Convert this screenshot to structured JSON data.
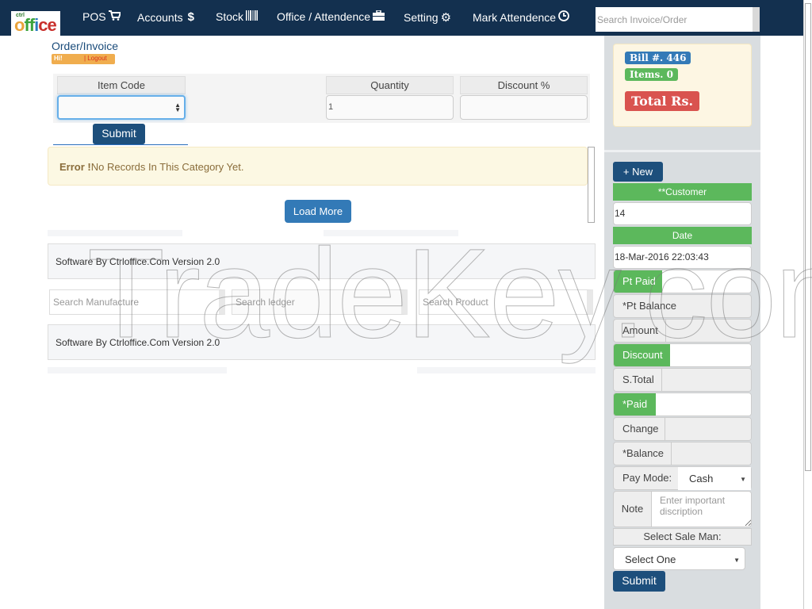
{
  "navbar": {
    "logo": {
      "small": "ctrl",
      "main": "office"
    },
    "items": [
      {
        "label": "POS",
        "icon": "shopping-cart-icon",
        "glyph": "🛒"
      },
      {
        "label": "Accounts",
        "icon": "dollar-icon",
        "glyph": "$"
      },
      {
        "label": "Stock",
        "icon": "barcode-icon",
        "glyph": "▌▌▌"
      },
      {
        "label": "Office / Attendence",
        "icon": "briefcase-icon",
        "glyph": "💼"
      },
      {
        "label": "Setting",
        "icon": "gear-icon",
        "glyph": "⚙"
      },
      {
        "label": "Mark Attendence",
        "icon": "clock-icon",
        "glyph": "🕓"
      }
    ],
    "search_placeholder": "Search Invoice/Order"
  },
  "page": {
    "title": "Order/Invoice",
    "greeting": "Hi!",
    "logout_label": "| Logout"
  },
  "order_form": {
    "item_code_label": "Item Code",
    "item_code_value": "",
    "quantity_label": "Quantity",
    "quantity_value": "1",
    "discount_label": "Discount %",
    "discount_value": "",
    "submit_label": "Submit"
  },
  "alert": {
    "title": "Error !",
    "message": "No Records In This Category Yet."
  },
  "load_more_label": "Load More",
  "footer_text": "Software By Ctrloffice.Com Version 2.0",
  "search_fields": {
    "manufacture_placeholder": "Search Manufacture",
    "ledger_placeholder": "Search ledger",
    "product_placeholder": "Search Product"
  },
  "sidebar": {
    "bill": "Bill #. 446",
    "items": "Items. 0",
    "total": "Total Rs.",
    "new_label": "+ New",
    "customer_label": "**Customer",
    "customer_value": "14",
    "date_label": "Date",
    "date_value": "18-Mar-2016 22:03:43",
    "rows": [
      {
        "label": "Pt Paid",
        "value": ""
      },
      {
        "label": "*Pt Balance",
        "value": ""
      },
      {
        "label": "Amount",
        "value": ""
      },
      {
        "label": "Discount",
        "value": ""
      },
      {
        "label": "S.Total",
        "value": ""
      },
      {
        "label": "*Paid",
        "value": ""
      },
      {
        "label": "Change",
        "value": ""
      },
      {
        "label": "*Balance",
        "value": ""
      }
    ],
    "pay_mode_label": "Pay Mode:",
    "pay_mode_value": "Cash",
    "note_label": "Note",
    "note_placeholder": "Enter important discription",
    "salesman_label": "Select Sale Man:",
    "salesman_value": "Select One",
    "submit_label": "Submit"
  },
  "watermark": "TradeKey.com"
}
